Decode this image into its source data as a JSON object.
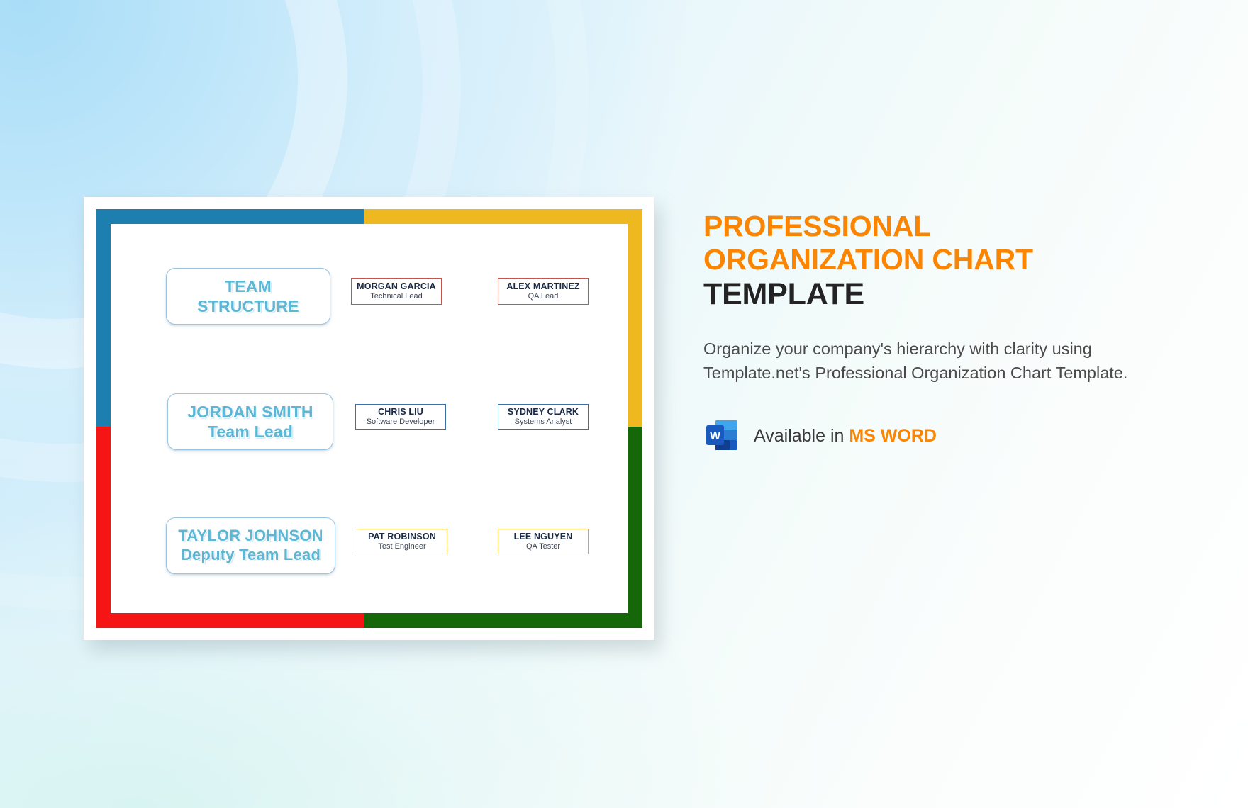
{
  "slide": {
    "frame_colors": {
      "top_left": "#1d7fb0",
      "top_right": "#eeb821",
      "bottom_left": "#f51515",
      "bottom_right": "#15670a"
    },
    "lead_boxes": [
      {
        "line1": "TEAM",
        "line2": "STRUCTURE"
      },
      {
        "line1": "JORDAN SMITH",
        "line2": "Team Lead"
      },
      {
        "line1": "TAYLOR JOHNSON",
        "line2": "Deputy Team Lead"
      }
    ],
    "members": [
      {
        "name": "MORGAN GARCIA",
        "role": "Technical Lead",
        "border": "#c5544c"
      },
      {
        "name": "ALEX MARTINEZ",
        "role": "QA Lead",
        "border": "#c5544c"
      },
      {
        "name": "CHRIS LIU",
        "role": "Software Developer",
        "border": "#3b6fae"
      },
      {
        "name": "SYDNEY CLARK",
        "role": "Systems Analyst",
        "border": "#3b6fae"
      },
      {
        "name": "PAT ROBINSON",
        "role": "Test Engineer",
        "border": "#f09b2e"
      },
      {
        "name": "LEE NGUYEN",
        "role": "QA Tester",
        "border": "#f09b2e"
      }
    ]
  },
  "info": {
    "title_line1": "PROFESSIONAL",
    "title_line2": "ORGANIZATION CHART",
    "title_line3": "TEMPLATE",
    "description": "Organize your company's hierarchy with clarity using Template.net's Professional Organization Chart Template.",
    "available_prefix": "Available in ",
    "available_format": "MS WORD",
    "accent_color": "#fb8500",
    "icon_name": "ms-word-icon"
  }
}
